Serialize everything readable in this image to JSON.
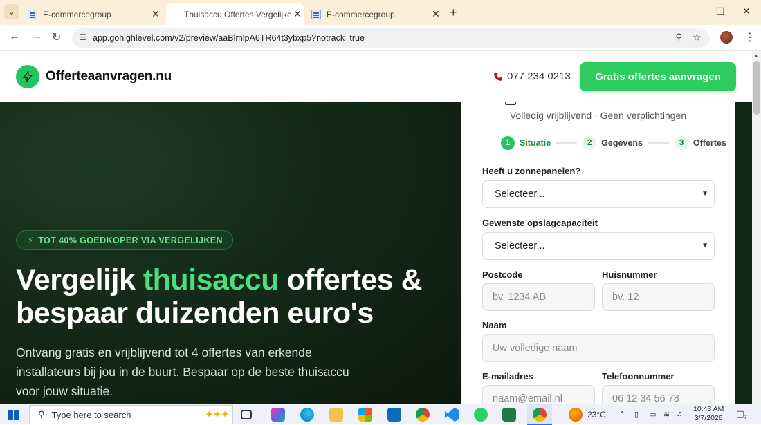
{
  "browser": {
    "tabs": [
      {
        "title": "E-commercegroup",
        "active": false
      },
      {
        "title": "Thuisaccu Offertes Vergelijken |",
        "active": true
      },
      {
        "title": "E-commercegroup",
        "active": false
      }
    ],
    "new_tab_label": "+",
    "url": "app.gohighlevel.com/v2/preview/aaBlmlpA6TR64t3ybxp5?notrack=true"
  },
  "site": {
    "logo_text": "Offerteaanvragen.nu",
    "phone": "077 234 0213",
    "cta_label": "Gratis offertes aanvragen"
  },
  "hero": {
    "badge": "TOT 40% GOEDKOPER VIA VERGELIJKEN",
    "headline_part1": "Vergelijk ",
    "headline_accent": "thuisaccu",
    "headline_part2": " offertes & bespaar duizenden euro's",
    "subtext": "Ontvang gratis en vrijblijvend tot 4 offertes van erkende installateurs bij jou in de buurt. Bespaar op de beste thuisaccu voor jouw situatie."
  },
  "form": {
    "subtitle": "Volledig vrijblijvend · Geen verplichtingen",
    "steps": [
      {
        "num": "1",
        "label": "Situatie",
        "active": true
      },
      {
        "num": "2",
        "label": "Gegevens",
        "active": false
      },
      {
        "num": "3",
        "label": "Offertes",
        "active": false
      }
    ],
    "zonnepanelen": {
      "label": "Heeft u zonnepanelen?",
      "value": "Selecteer..."
    },
    "opslag": {
      "label": "Gewenste opslagcapaciteit",
      "value": "Selecteer..."
    },
    "postcode": {
      "label": "Postcode",
      "placeholder": "bv. 1234 AB"
    },
    "huisnummer": {
      "label": "Huisnummer",
      "placeholder": "bv. 12"
    },
    "naam": {
      "label": "Naam",
      "placeholder": "Uw volledige naam"
    },
    "email": {
      "label": "E-mailadres",
      "placeholder": "naam@email.nl"
    },
    "telefoon": {
      "label": "Telefoonnummer",
      "placeholder": "06 12 34 56 78"
    }
  },
  "taskbar": {
    "search_placeholder": "Type here to search",
    "weather": "23°C",
    "time": "10:43 AM",
    "date": "3/7/2026",
    "notification_count": "7"
  },
  "colors": {
    "accent_green": "#22c55e",
    "cta_green": "#2ecc5f",
    "hero_bg": "#142a17",
    "tab_strip": "#fcefd9"
  }
}
